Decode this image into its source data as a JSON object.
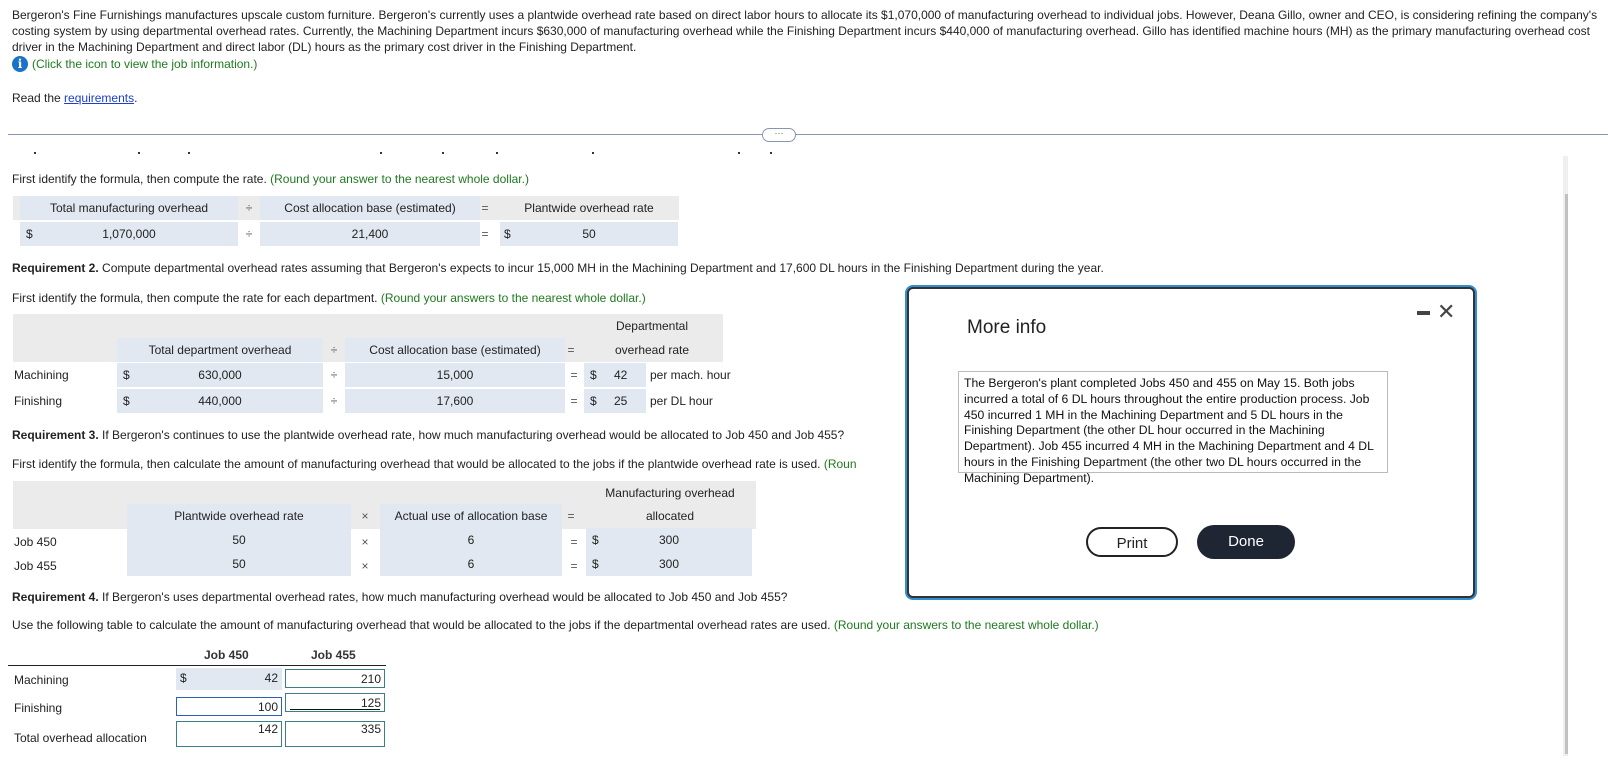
{
  "intro": {
    "paragraph": "Bergeron's Fine Furnishings manufactures upscale custom furniture. Bergeron's currently uses a plantwide overhead rate based on direct labor hours to allocate its $1,070,000 of manufacturing overhead to individual jobs. However, Deana Gillo, owner and CEO, is considering refining the company's costing system by using departmental overhead rates. Currently, the Machining Department incurs $630,000 of manufacturing overhead while the Finishing Department incurs $440,000 of manufacturing overhead. Gillo has identified machine hours (MH) as the primary manufacturing overhead cost driver in the Machining Department and direct labor (DL) hours as the primary cost driver in the Finishing Department.",
    "info_link": "(Click the icon to view the job information.)",
    "info_icon": "info-icon",
    "read_prefix": "Read the ",
    "read_link": "requirements",
    "read_suffix": ".",
    "expander": "···"
  },
  "req1": {
    "instruction": "First identify the formula, then compute the rate.",
    "hint": "(Round your answer to the nearest whole dollar.)",
    "headers": {
      "col1": "Total manufacturing overhead",
      "op1": "÷",
      "col2": "Cost allocation base (estimated)",
      "op2": "=",
      "col3": "Plantwide overhead rate"
    },
    "row": {
      "cur1": "$",
      "val1": "1,070,000",
      "op1": "÷",
      "val2": "21,400",
      "op2": "=",
      "cur3": "$",
      "val3": "50"
    }
  },
  "req2": {
    "title_bold": "Requirement 2.",
    "title": " Compute departmental overhead rates assuming that Bergeron's expects to incur 15,000 MH in the Machining Department and 17,600 DL hours in the Finishing Department during the year.",
    "instruction": "First identify the formula, then compute the rate for each department.",
    "hint": "(Round your answers to the nearest whole dollar.)",
    "headers": {
      "col1": "Total department overhead",
      "op1": "÷",
      "col2": "Cost allocation base (estimated)",
      "op2": "=",
      "col3a": "Departmental",
      "col3b": "overhead rate"
    },
    "rows": [
      {
        "label": "Machining",
        "cur1": "$",
        "val1": "630,000",
        "op1": "÷",
        "val2": "15,000",
        "op2": "=",
        "cur3": "$",
        "val3": "42",
        "unit": "per mach. hour"
      },
      {
        "label": "Finishing",
        "cur1": "$",
        "val1": "440,000",
        "op1": "÷",
        "val2": "17,600",
        "op2": "=",
        "cur3": "$",
        "val3": "25",
        "unit": "per DL hour"
      }
    ]
  },
  "req3": {
    "title_bold": "Requirement 3.",
    "title": " If Bergeron's continues to use the plantwide overhead rate, how much manufacturing overhead would be allocated to Job 450 and Job 455?",
    "instruction": "First identify the formula, then calculate the amount of manufacturing overhead that would be allocated to the jobs if the plantwide overhead rate is used.",
    "hint": "(Roun",
    "headers": {
      "col1": "Plantwide overhead rate",
      "op1": "×",
      "col2": "Actual use of allocation base",
      "op2": "=",
      "col3a": "Manufacturing overhead",
      "col3b": "allocated"
    },
    "rows": [
      {
        "label": "Job 450",
        "val1": "50",
        "op1": "×",
        "val2": "6",
        "op2": "=",
        "cur3": "$",
        "val3": "300"
      },
      {
        "label": "Job 455",
        "val1": "50",
        "op1": "×",
        "val2": "6",
        "op2": "=",
        "cur3": "$",
        "val3": "300"
      }
    ]
  },
  "req4": {
    "title_bold": "Requirement 4.",
    "title": " If Bergeron's uses departmental overhead rates, how much manufacturing overhead would be allocated to Job 450 and Job 455?",
    "instruction": "Use the following table to calculate the amount of manufacturing overhead that would be allocated to the jobs if the departmental overhead rates are used.",
    "hint": "(Round your answers to the nearest whole dollar.)",
    "columns": [
      "Job 450",
      "Job 455"
    ],
    "rows": [
      {
        "label": "Machining",
        "cur": "$",
        "job450": "42",
        "job455": "210"
      },
      {
        "label": "Finishing",
        "job450": "100",
        "job455": "125"
      },
      {
        "label": "Total overhead allocation",
        "job450": "142",
        "job455": "335"
      }
    ]
  },
  "modal": {
    "title": "More info",
    "minimize_icon": "minimize-icon",
    "close_icon": "close-icon",
    "close_glyph": "✕",
    "body": "The Bergeron's plant completed Jobs 450 and 455 on May 15. Both jobs incurred a total of 6 DL hours throughout the entire production process. Job 450 incurred 1 MH in the Machining Department and 5 DL hours in the Finishing Department (the other DL hour occurred in the Machining Department). Job 455 incurred 4 MH in the Machining Department and 4 DL hours in the Finishing Department (the other two DL hours occurred in the Machining Department).",
    "print_label": "Print",
    "done_label": "Done"
  },
  "colors": {
    "accent_blue": "#1a73c7",
    "hint_green": "#1f7a1f",
    "link_blue": "#1a3fd1",
    "done_bg": "#1e2533",
    "cell_bg": "#e2e8f1",
    "header_bg": "#ebebeb"
  }
}
